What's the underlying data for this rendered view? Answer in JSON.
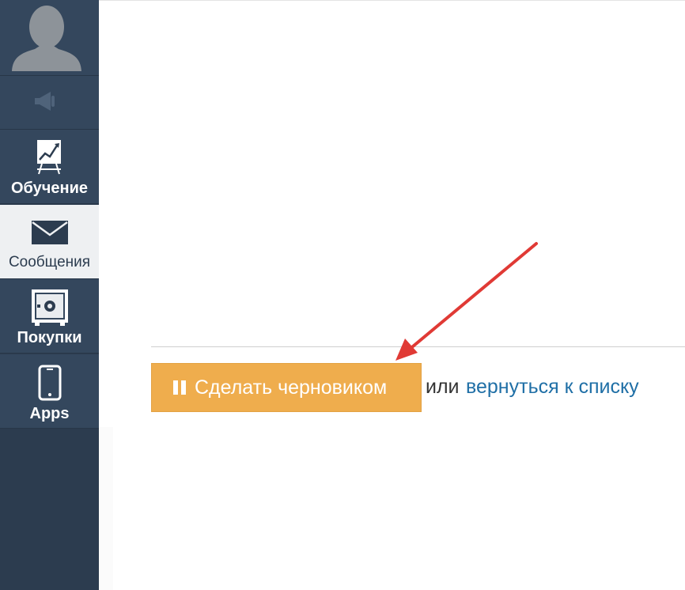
{
  "sidebar": {
    "items": [
      {
        "label": "Обучение",
        "icon": "presentation-chart-icon"
      },
      {
        "label": "Сообщения",
        "icon": "envelope-icon"
      },
      {
        "label": "Покупки",
        "icon": "safe-icon"
      },
      {
        "label": "Apps",
        "icon": "smartphone-icon"
      }
    ]
  },
  "main": {
    "draft_button_label": "Сделать черновиком",
    "or_text": "или",
    "back_link_label": "вернуться к списку"
  },
  "colors": {
    "sidebar_bg": "#34475d",
    "button_orange": "#efad4d",
    "link_blue": "#1f6fa6",
    "annotation_arrow": "#e03a35"
  }
}
